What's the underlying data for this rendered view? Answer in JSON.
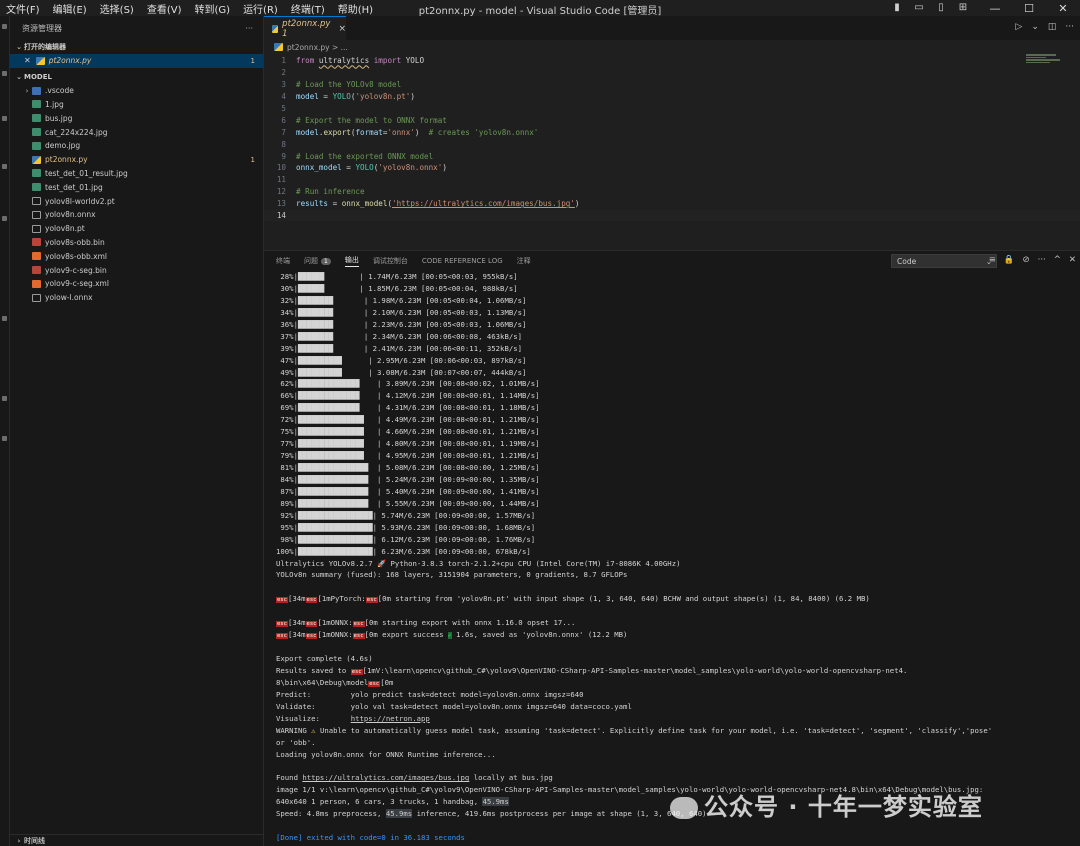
{
  "menu": [
    "文件(F)",
    "编辑(E)",
    "选择(S)",
    "查看(V)",
    "转到(G)",
    "运行(R)",
    "终端(T)",
    "帮助(H)"
  ],
  "window_title": "pt2onnx.py - model - Visual Studio Code [管理员]",
  "sidebar": {
    "title": "资源管理器",
    "more": "···",
    "open_editors_label": "打开的编辑器",
    "open_editor": {
      "name": "pt2onnx.py",
      "badge": "1"
    },
    "folder_label": "MODEL",
    "files": [
      {
        "name": ".vscode",
        "type": "folder",
        "badge": ""
      },
      {
        "name": "1.jpg",
        "type": "img",
        "badge": ""
      },
      {
        "name": "bus.jpg",
        "type": "img",
        "badge": ""
      },
      {
        "name": "cat_224x224.jpg",
        "type": "img",
        "badge": ""
      },
      {
        "name": "demo.jpg",
        "type": "img",
        "badge": ""
      },
      {
        "name": "pt2onnx.py",
        "type": "py",
        "badge": "1"
      },
      {
        "name": "test_det_01_result.jpg",
        "type": "img",
        "badge": ""
      },
      {
        "name": "test_det_01.jpg",
        "type": "img",
        "badge": ""
      },
      {
        "name": "yolov8l-worldv2.pt",
        "type": "doc",
        "badge": ""
      },
      {
        "name": "yolov8n.onnx",
        "type": "doc",
        "badge": ""
      },
      {
        "name": "yolov8n.pt",
        "type": "doc",
        "badge": ""
      },
      {
        "name": "yolov8s-obb.bin",
        "type": "bin",
        "badge": ""
      },
      {
        "name": "yolov8s-obb.xml",
        "type": "xml",
        "badge": ""
      },
      {
        "name": "yolov9-c-seg.bin",
        "type": "bin",
        "badge": ""
      },
      {
        "name": "yolov9-c-seg.xml",
        "type": "xml",
        "badge": ""
      },
      {
        "name": "yolow-l.onnx",
        "type": "doc",
        "badge": ""
      }
    ],
    "timeline_label": "时间线"
  },
  "editor": {
    "tab_label": "pt2onnx.py 1",
    "tab_close": "×",
    "breadcrumb": "pt2onnx.py > ...",
    "code_lines": [
      {
        "n": "1",
        "segs": [
          [
            "k",
            "from "
          ],
          [
            "p",
            "ultralytics"
          ],
          [
            "k",
            " import "
          ],
          [
            "p",
            "YOLO"
          ]
        ]
      },
      {
        "n": "2",
        "segs": []
      },
      {
        "n": "3",
        "segs": [
          [
            "c",
            "# Load the YOLOv8 model"
          ]
        ]
      },
      {
        "n": "4",
        "segs": [
          [
            "v",
            "model"
          ],
          [
            "p",
            " = "
          ],
          [
            "t",
            "YOLO"
          ],
          [
            "p",
            "("
          ],
          [
            "s",
            "'yolov8n.pt'"
          ],
          [
            "p",
            ")"
          ]
        ]
      },
      {
        "n": "5",
        "segs": []
      },
      {
        "n": "6",
        "segs": [
          [
            "c",
            "# Export the model to ONNX format"
          ]
        ]
      },
      {
        "n": "7",
        "segs": [
          [
            "v",
            "model"
          ],
          [
            "p",
            "."
          ],
          [
            "fn",
            "export"
          ],
          [
            "p",
            "("
          ],
          [
            "v",
            "format"
          ],
          [
            "p",
            "="
          ],
          [
            "s",
            "'onnx'"
          ],
          [
            "p",
            ")  "
          ],
          [
            "c",
            "# creates 'yolov8n.onnx'"
          ]
        ]
      },
      {
        "n": "8",
        "segs": []
      },
      {
        "n": "9",
        "segs": [
          [
            "c",
            "# Load the exported ONNX model"
          ]
        ]
      },
      {
        "n": "10",
        "segs": [
          [
            "v",
            "onnx_model"
          ],
          [
            "p",
            " = "
          ],
          [
            "t",
            "YOLO"
          ],
          [
            "p",
            "("
          ],
          [
            "s",
            "'yolov8n.onnx'"
          ],
          [
            "p",
            ")"
          ]
        ]
      },
      {
        "n": "11",
        "segs": []
      },
      {
        "n": "12",
        "segs": [
          [
            "c",
            "# Run inference"
          ]
        ]
      },
      {
        "n": "13",
        "segs": [
          [
            "v",
            "results"
          ],
          [
            "p",
            " = "
          ],
          [
            "fn",
            "onnx_model"
          ],
          [
            "p",
            "("
          ],
          [
            "s",
            "'https://ultralytics.com/images/bus.jpg'"
          ],
          [
            "p",
            ")"
          ]
        ]
      },
      {
        "n": "14",
        "segs": []
      }
    ]
  },
  "panel": {
    "tabs": [
      {
        "label": "终端",
        "badge": ""
      },
      {
        "label": "问题",
        "badge": "1"
      },
      {
        "label": "输出",
        "badge": ""
      },
      {
        "label": "调试控制台",
        "badge": ""
      },
      {
        "label": "CODE REFERENCE LOG",
        "badge": ""
      },
      {
        "label": "注释",
        "badge": ""
      }
    ],
    "active_tab": "输出",
    "select_value": "Code",
    "output": [
      [
        [
          "p",
          " 28%|██████        | 1.74M/6.23M [00:05<00:03, 955kB/s]"
        ]
      ],
      [
        [
          "p",
          " 30%|██████        | 1.85M/6.23M [00:05<00:04, 988kB/s]"
        ]
      ],
      [
        [
          "p",
          " 32%|████████       | 1.98M/6.23M [00:05<00:04, 1.06MB/s]"
        ]
      ],
      [
        [
          "p",
          " 34%|████████       | 2.10M/6.23M [00:05<00:03, 1.13MB/s]"
        ]
      ],
      [
        [
          "p",
          " 36%|████████       | 2.23M/6.23M [00:05<00:03, 1.06MB/s]"
        ]
      ],
      [
        [
          "p",
          " 37%|████████       | 2.34M/6.23M [00:06<00:08, 463kB/s]"
        ]
      ],
      [
        [
          "p",
          " 39%|████████       | 2.41M/6.23M [00:06<00:11, 352kB/s]"
        ]
      ],
      [
        [
          "p",
          " 47%|██████████      | 2.95M/6.23M [00:06<00:03, 897kB/s]"
        ]
      ],
      [
        [
          "p",
          " 49%|██████████      | 3.08M/6.23M [00:07<00:07, 444kB/s]"
        ]
      ],
      [
        [
          "p",
          " 62%|██████████████    | 3.89M/6.23M [00:08<00:02, 1.01MB/s]"
        ]
      ],
      [
        [
          "p",
          " 66%|██████████████    | 4.12M/6.23M [00:08<00:01, 1.14MB/s]"
        ]
      ],
      [
        [
          "p",
          " 69%|██████████████    | 4.31M/6.23M [00:08<00:01, 1.18MB/s]"
        ]
      ],
      [
        [
          "p",
          " 72%|███████████████   | 4.49M/6.23M [00:08<00:01, 1.21MB/s]"
        ]
      ],
      [
        [
          "p",
          " 75%|███████████████   | 4.66M/6.23M [00:08<00:01, 1.21MB/s]"
        ]
      ],
      [
        [
          "p",
          " 77%|███████████████   | 4.80M/6.23M [00:08<00:01, 1.19MB/s]"
        ]
      ],
      [
        [
          "p",
          " 79%|███████████████   | 4.95M/6.23M [00:08<00:01, 1.21MB/s]"
        ]
      ],
      [
        [
          "p",
          " 81%|████████████████  | 5.08M/6.23M [00:08<00:00, 1.25MB/s]"
        ]
      ],
      [
        [
          "p",
          " 84%|████████████████  | 5.24M/6.23M [00:09<00:00, 1.35MB/s]"
        ]
      ],
      [
        [
          "p",
          " 87%|████████████████  | 5.40M/6.23M [00:09<00:00, 1.41MB/s]"
        ]
      ],
      [
        [
          "p",
          " 89%|████████████████  | 5.55M/6.23M [00:09<00:00, 1.44MB/s]"
        ]
      ],
      [
        [
          "p",
          " 92%|█████████████████| 5.74M/6.23M [00:09<00:00, 1.57MB/s]"
        ]
      ],
      [
        [
          "p",
          " 95%|█████████████████| 5.93M/6.23M [00:09<00:00, 1.68MB/s]"
        ]
      ],
      [
        [
          "p",
          " 98%|█████████████████| 6.12M/6.23M [00:09<00:00, 1.76MB/s]"
        ]
      ],
      [
        [
          "p",
          "100%|█████████████████| 6.23M/6.23M [00:09<00:00, 678kB/s]"
        ]
      ],
      [
        [
          "p",
          "Ultralytics YOLOv8.2.7 "
        ],
        [
          "rocket",
          "🚀"
        ],
        [
          "p",
          " Python-3.8.3 torch-2.1.2+cpu CPU (Intel Core(TM) i7-8086K 4.00GHz)"
        ]
      ],
      [
        [
          "p",
          "YOLOv8n summary (fused): 168 layers, 3151904 parameters, 0 gradients, 8.7 GFLOPs"
        ]
      ],
      [],
      [
        [
          "esc",
          "esc"
        ],
        [
          "p",
          "[34m"
        ],
        [
          "esc",
          "esc"
        ],
        [
          "p",
          "[1mPyTorch:"
        ],
        [
          "esc",
          "esc"
        ],
        [
          "p",
          "[0m starting from 'yolov8n.pt' with input shape (1, 3, 640, 640) BCHW and output shape(s) (1, 84, 8400) (6.2 MB)"
        ]
      ],
      [],
      [
        [
          "esc",
          "esc"
        ],
        [
          "p",
          "[34m"
        ],
        [
          "esc",
          "esc"
        ],
        [
          "p",
          "[1mONNX:"
        ],
        [
          "esc",
          "esc"
        ],
        [
          "p",
          "[0m starting export with onnx 1.16.0 opset 17..."
        ]
      ],
      [
        [
          "esc",
          "esc"
        ],
        [
          "p",
          "[34m"
        ],
        [
          "esc",
          "esc"
        ],
        [
          "p",
          "[1mONNX:"
        ],
        [
          "esc",
          "esc"
        ],
        [
          "p",
          "[0m export success "
        ],
        [
          "green",
          "✔"
        ],
        [
          "p",
          " 1.6s, saved as 'yolov8n.onnx' (12.2 MB)"
        ]
      ],
      [],
      [
        [
          "p",
          "Export complete (4.6s)"
        ]
      ],
      [
        [
          "p",
          "Results saved to "
        ],
        [
          "esc",
          "esc"
        ],
        [
          "p",
          "[1mV:\\learn\\opencv\\github_C#\\yolov9\\OpenVINO-CSharp-API-Samples-master\\model_samples\\yolo-world\\yolo-world-opencvsharp-net4."
        ]
      ],
      [
        [
          "p",
          "8\\bin\\x64\\Debug\\model"
        ],
        [
          "esc",
          "esc"
        ],
        [
          "p",
          "[0m"
        ]
      ],
      [
        [
          "p",
          "Predict:         yolo predict task=detect model=yolov8n.onnx imgsz=640"
        ]
      ],
      [
        [
          "p",
          "Validate:        yolo val task=detect model=yolov8n.onnx imgsz=640 data=coco.yaml"
        ]
      ],
      [
        [
          "p",
          "Visualize:       "
        ],
        [
          "url",
          "https://netron.app"
        ]
      ],
      [
        [
          "p",
          "WARNING "
        ],
        [
          "warn",
          "⚠"
        ],
        [
          "p",
          " Unable to automatically guess model task, assuming 'task=detect'. Explicitly define task for your model, i.e. 'task=detect', 'segment', 'classify','pose'"
        ]
      ],
      [
        [
          "p",
          "or 'obb'."
        ]
      ],
      [
        [
          "p",
          "Loading yolov8n.onnx for ONNX Runtime inference..."
        ]
      ],
      [],
      [
        [
          "p",
          "Found "
        ],
        [
          "url",
          "https://ultralytics.com/images/bus.jpg"
        ],
        [
          "p",
          " locally at bus.jpg"
        ]
      ],
      [
        [
          "p",
          "image 1/1 v:\\learn\\opencv\\github_C#\\yolov9\\OpenVINO-CSharp-API-Samples-master\\model_samples\\yolo-world\\yolo-world-opencvsharp-net4.8\\bin\\x64\\Debug\\model\\bus.jpg:"
        ]
      ],
      [
        [
          "p",
          "640x640 1 person, 6 cars, 3 trucks, 1 handbag, "
        ],
        [
          "hl",
          "45.9ms"
        ]
      ],
      [
        [
          "p",
          "Speed: 4.8ms preprocess, "
        ],
        [
          "hl",
          "45.9ms"
        ],
        [
          "p",
          " inference, 419.6ms postprocess per image at shape (1, 3, 640, 640)"
        ]
      ],
      [],
      [
        [
          "done",
          "[Done] exited with code=0 in 36.183 seconds"
        ]
      ]
    ]
  },
  "watermark": "公众号 · 十年一梦实验室"
}
